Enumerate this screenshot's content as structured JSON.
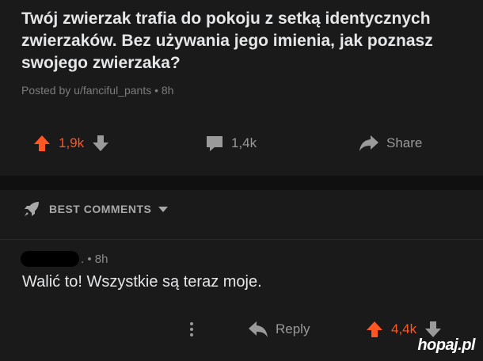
{
  "post": {
    "title": "Twój zwierzak trafia do pokoju z setką identycznych zwierzaków. Bez używania jego imienia, jak poznasz swojego zwierzaka?",
    "meta": "Posted by u/fanciful_pants • 8h",
    "upvotes": "1,9k",
    "comments": "1,4k",
    "share_label": "Share"
  },
  "best_comments": {
    "label": "BEST COMMENTS"
  },
  "comment": {
    "time": ". • 8h",
    "body": "Walić to! Wszystkie są teraz moje.",
    "reply_label": "Reply",
    "score": "4,4k"
  },
  "watermark": "hopaj.pl",
  "colors": {
    "upvote": "#ff5622",
    "background": "#1a1a1b",
    "separator": "#101011"
  },
  "icons": [
    "upvote-icon",
    "downvote-icon",
    "comment-icon",
    "share-icon",
    "rocket-icon",
    "chevron-down-icon",
    "more-icon",
    "reply-icon"
  ]
}
